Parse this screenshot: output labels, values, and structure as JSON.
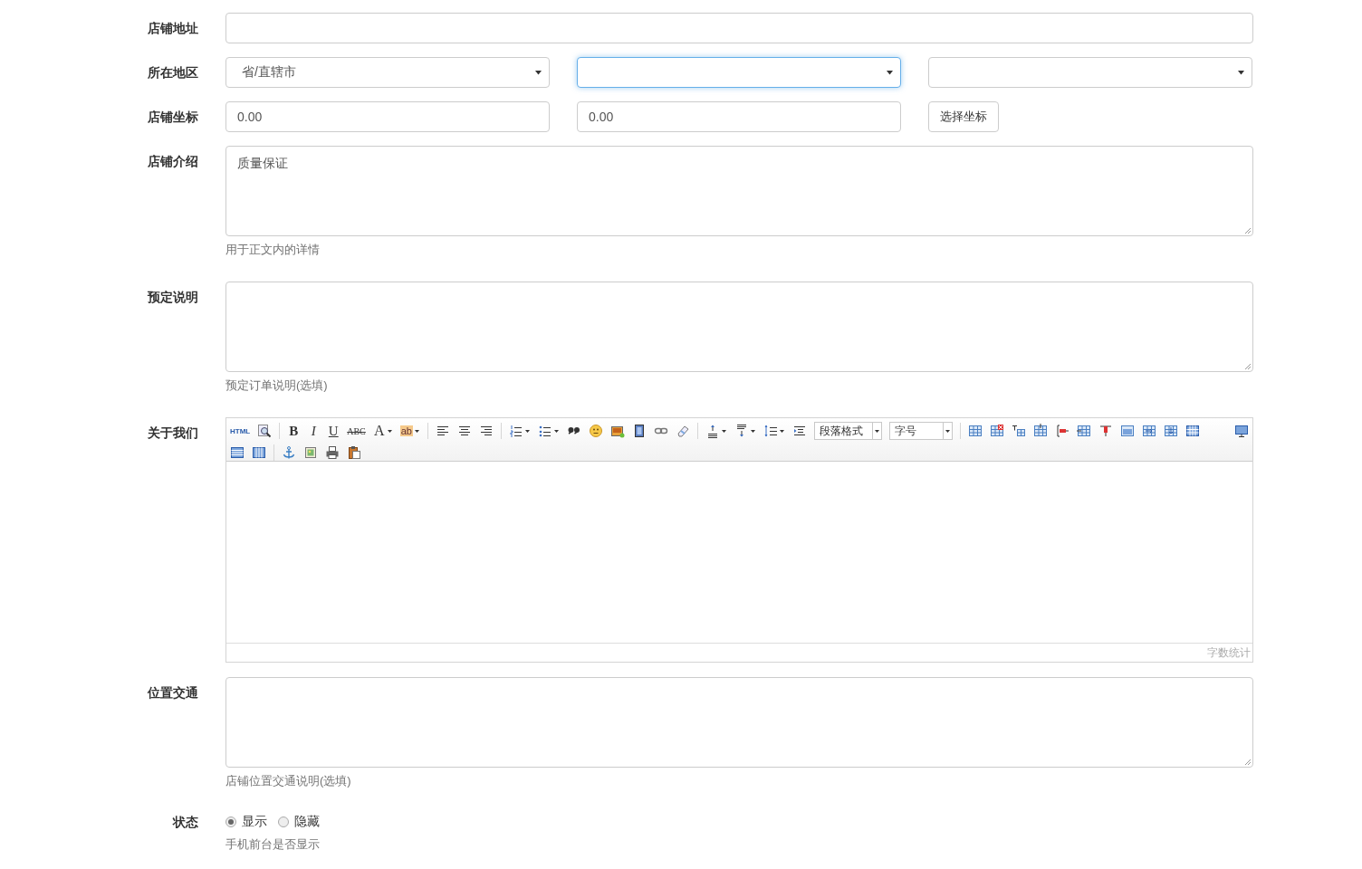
{
  "rows": [
    {
      "kind": "input",
      "label": "店铺地址"
    },
    {
      "kind": "selects",
      "label": "所在地区",
      "selects": [
        {
          "value": "省/直辖市",
          "focused": false
        },
        {
          "focused": true
        },
        {
          "focused": false
        }
      ]
    },
    {
      "kind": "coords",
      "label": "店铺坐标",
      "inputs": [
        "0.00",
        "0.00"
      ],
      "button": "选择坐标"
    },
    {
      "kind": "textarea",
      "label": "店铺介绍",
      "value": "质量保证",
      "help": "用于正文内的详情"
    },
    {
      "kind": "textarea",
      "label": "预定说明",
      "help": "预定订单说明(选填)"
    },
    {
      "kind": "editor",
      "label": "关于我们",
      "toolbar_texts": [
        "HTML",
        "B",
        "I",
        "U",
        "ABC",
        "A",
        "ab"
      ],
      "paragraph_select": "段落格式",
      "size_select": "字号",
      "word_count": "字数统计"
    },
    {
      "kind": "textarea",
      "label": "位置交通",
      "help": "店铺位置交通说明(选填)"
    },
    {
      "kind": "radios",
      "label": "状态",
      "options": [
        {
          "label": "显示",
          "selected": true
        },
        {
          "label": "隐藏",
          "selected": false
        }
      ],
      "help": "手机前台是否显示"
    }
  ]
}
